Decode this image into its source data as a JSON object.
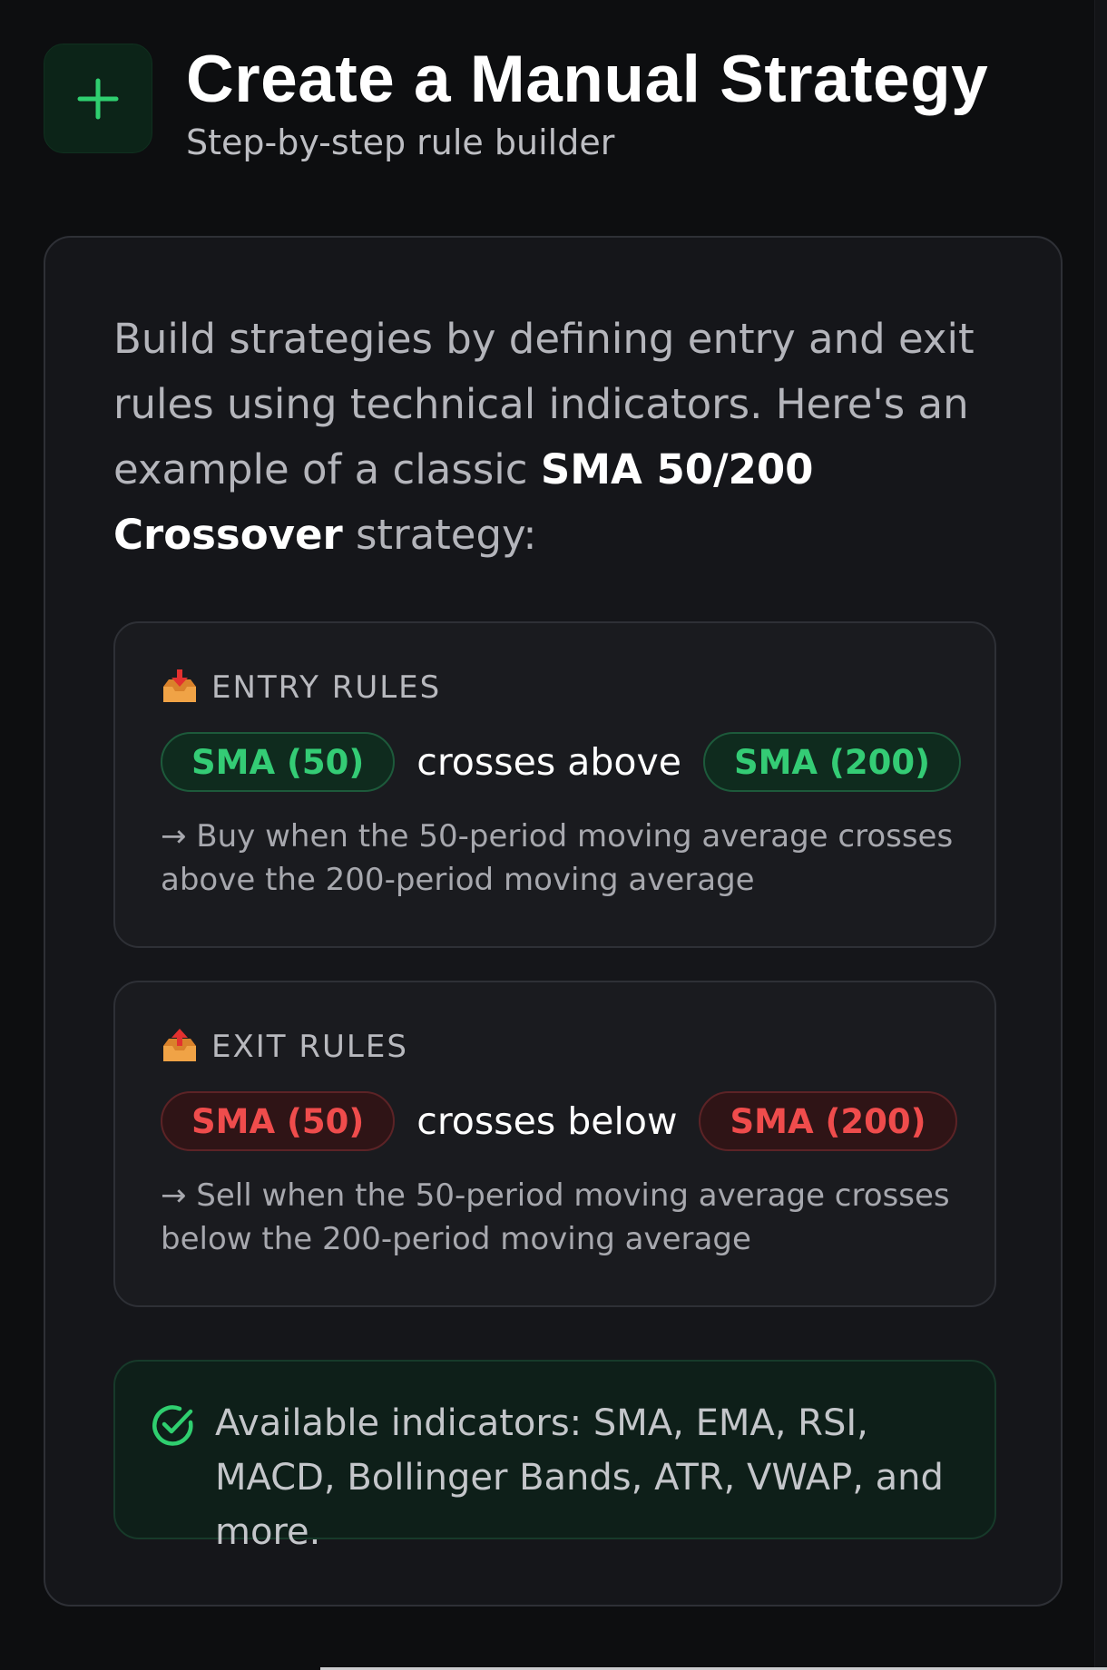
{
  "header": {
    "title": "Create a Manual Strategy",
    "subtitle": "Step-by-step rule builder",
    "add_icon": "plus-icon"
  },
  "intro": {
    "text_before": "Build strategies by defining entry and exit rules using technical indicators. Here's an example of a classic ",
    "highlight": "SMA 50/200 Crossover",
    "text_after": " strategy:"
  },
  "entry_rules": {
    "icon": "inbox-tray-icon",
    "label": "ENTRY RULES",
    "left_indicator": "SMA (50)",
    "operator": "crosses above",
    "right_indicator": "SMA (200)",
    "description": "→ Buy when the 50-period moving average crosses above the 200-period moving average",
    "color": "#34cc75"
  },
  "exit_rules": {
    "icon": "outbox-tray-icon",
    "label": "EXIT RULES",
    "left_indicator": "SMA (50)",
    "operator": "crosses below",
    "right_indicator": "SMA (200)",
    "description": "→ Sell when the 50-period moving average crosses below the 200-period moving average",
    "color": "#ef4c4c"
  },
  "info": {
    "icon": "check-circle-icon",
    "text": "Available indicators: SMA, EMA, RSI, MACD, Bollinger Bands, ATR, VWAP, and more."
  },
  "colors": {
    "background": "#0d0e10",
    "card": "#15161a",
    "accent_green": "#34cc75",
    "accent_red": "#ef4c4c"
  }
}
